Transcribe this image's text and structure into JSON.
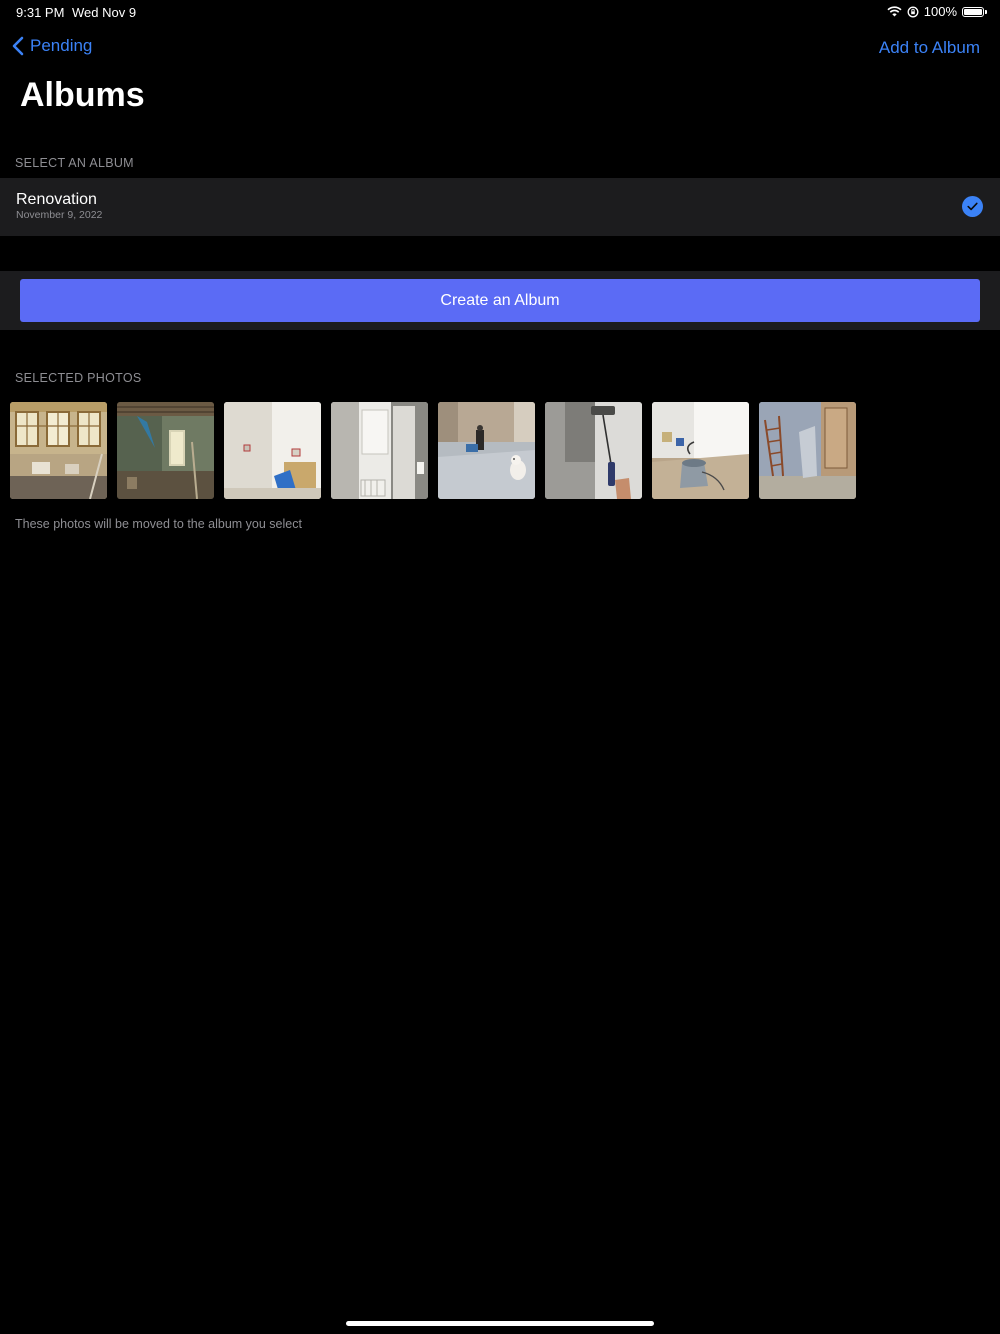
{
  "status_bar": {
    "time": "9:31 PM",
    "date": "Wed Nov 9",
    "battery": "100%",
    "battery_level": 1.0,
    "icons": [
      "wifi-icon",
      "lock-rotation-icon",
      "battery-icon"
    ]
  },
  "nav": {
    "back_label": "Pending",
    "back_icon": "chevron-left-icon",
    "action_label": "Add to Album",
    "accent_color": "#3b82f6"
  },
  "page": {
    "title": "Albums"
  },
  "albums_section": {
    "header": "SELECT AN ALBUM",
    "items": [
      {
        "name": "Renovation",
        "date": "November 9, 2022",
        "selected": true,
        "selected_icon": "checkmark-circle-icon"
      }
    ]
  },
  "create_album": {
    "label": "Create an Album",
    "color": "#5b6bf5"
  },
  "photos_section": {
    "header": "SELECTED PHOTOS",
    "photos": [
      {
        "subject": "room with tall windows"
      },
      {
        "subject": "stripped room with bare walls"
      },
      {
        "subject": "white plastered wall corner"
      },
      {
        "subject": "white door and radiator"
      },
      {
        "subject": "room with dog on floor"
      },
      {
        "subject": "paint roller on wall"
      },
      {
        "subject": "shop vacuum in empty room"
      },
      {
        "subject": "ladder against wall"
      }
    ],
    "footnote": "These photos will be moved to the album you select"
  }
}
